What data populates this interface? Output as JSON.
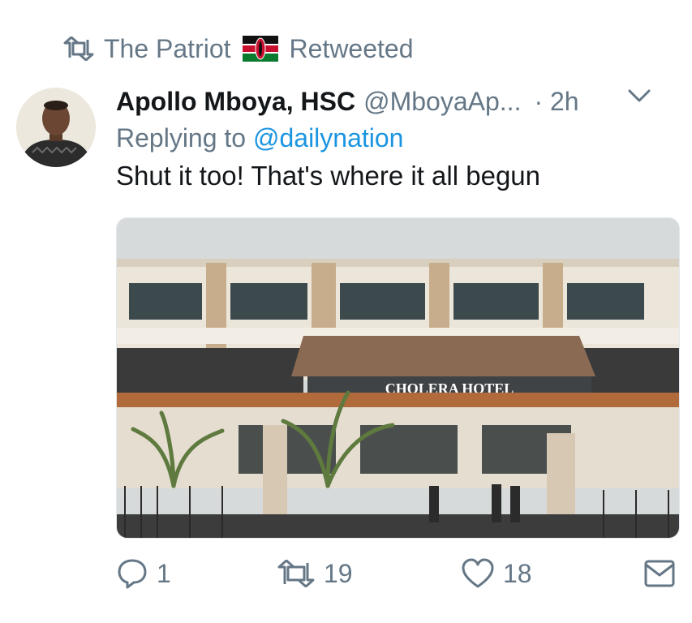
{
  "retweet_context": {
    "retweeter": "The Patriot",
    "label": "Retweeted"
  },
  "tweet": {
    "display_name": "Apollo Mboya, HSC",
    "handle": "@MboyaAp...",
    "time": "· 2h",
    "replying_prefix": "Replying to",
    "replying_to": "@dailynation",
    "text": "Shut it too! That's where it all begun",
    "image_sign_text": "CHOLERA HOTEL"
  },
  "actions": {
    "replies": "1",
    "retweets": "19",
    "likes": "18"
  },
  "colors": {
    "secondary_text": "#657786",
    "link": "#1b95e0",
    "primary_text": "#14171a"
  },
  "icons": [
    "retweet-icon",
    "kenya-flag-icon",
    "chevron-down-icon",
    "reply-icon",
    "retweet-icon",
    "like-icon",
    "message-icon"
  ]
}
